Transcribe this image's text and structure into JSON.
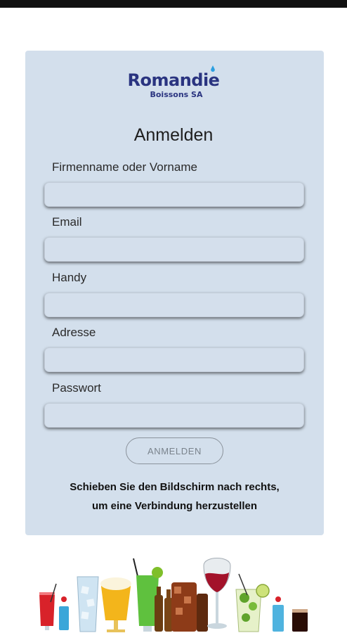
{
  "brand": {
    "name": "Romandie",
    "sub": "Boissons SA"
  },
  "form": {
    "title": "Anmelden",
    "fields": [
      {
        "label": "Firmenname oder Vorname",
        "value": ""
      },
      {
        "label": "Email",
        "value": ""
      },
      {
        "label": "Handy",
        "value": ""
      },
      {
        "label": "Adresse",
        "value": ""
      },
      {
        "label": "Passwort",
        "value": ""
      }
    ],
    "submit_label": "ANMELDEN",
    "hint_line1": "Schieben Sie den Bildschirm nach rechts,",
    "hint_line2": "um eine Verbindung herzustellen"
  },
  "colors": {
    "card": "#d3dfec",
    "brand": "#2a3480",
    "accent": "#2c9fe0"
  },
  "icons": {
    "logo_drop": "water-drop-icon",
    "footer": "drinks-illustration"
  }
}
